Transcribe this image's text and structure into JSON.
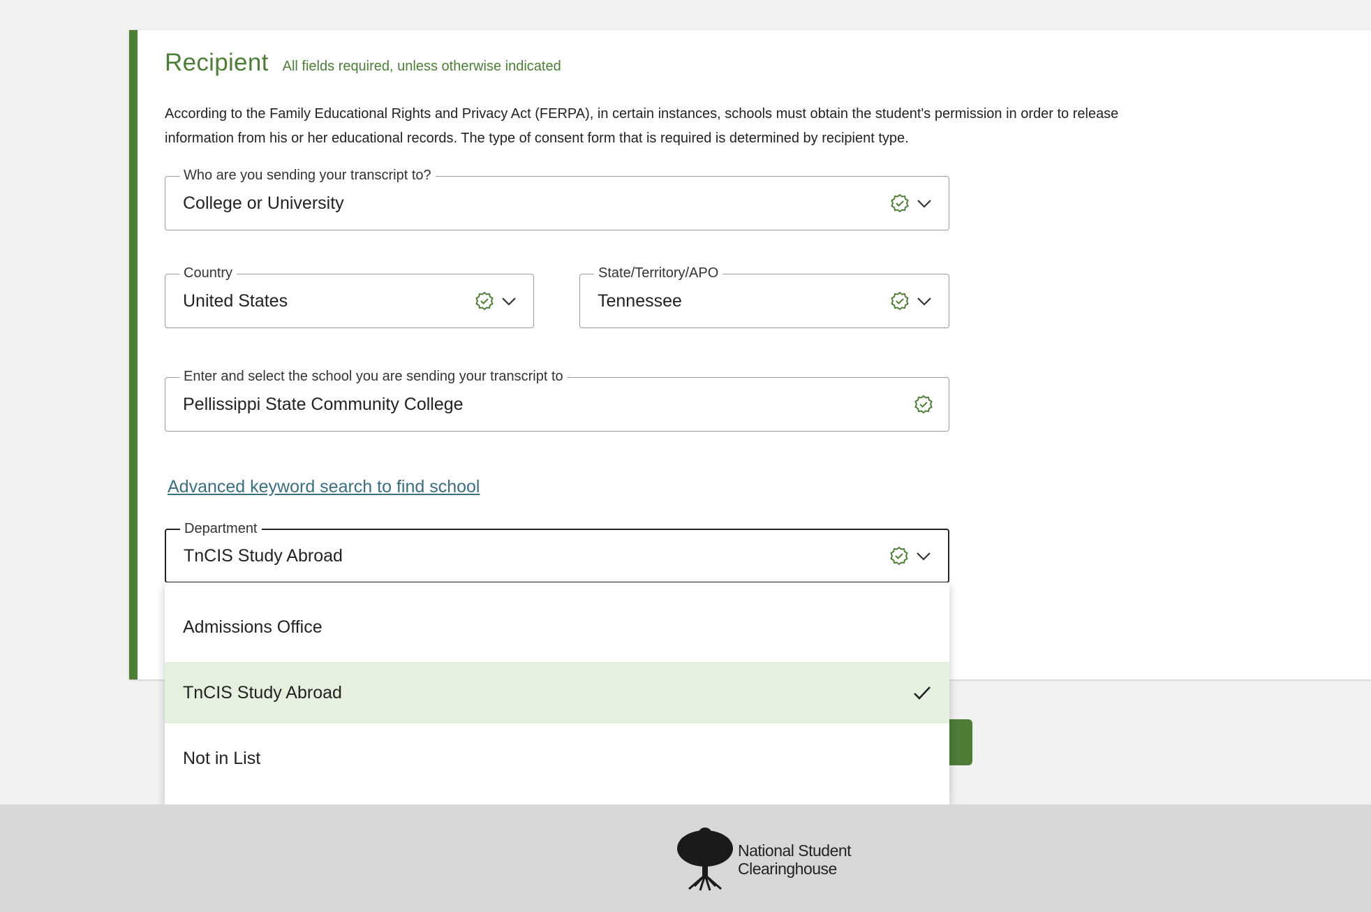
{
  "recipient": {
    "title": "Recipient",
    "subtitle": "All fields required, unless otherwise indicated",
    "intro": "According to the Family Educational Rights and Privacy Act (FERPA), in certain instances, schools must obtain the student's permission in order to release information from his or her educational records. The type of consent form that is required is determined by recipient type."
  },
  "fields": {
    "recipient_type": {
      "label": "Who are you sending your transcript to?",
      "value": "College or University"
    },
    "country": {
      "label": "Country",
      "value": "United States"
    },
    "state": {
      "label": "State/Territory/APO",
      "value": "Tennessee"
    },
    "school": {
      "label": "Enter and select the school you are sending your transcript to",
      "value": "Pellissippi State Community College"
    },
    "department": {
      "label": "Department",
      "value": "TnCIS Study Abroad"
    }
  },
  "advanced_search_link": "Advanced keyword search to find school",
  "department_options": [
    {
      "label": "Admissions Office",
      "selected": false
    },
    {
      "label": "TnCIS Study Abroad",
      "selected": true
    },
    {
      "label": "Not in List",
      "selected": false
    }
  ],
  "footer": {
    "logo_line1": "National Student",
    "logo_line2": "Clearinghouse"
  },
  "colors": {
    "brand_green": "#4e7d38",
    "selected_option_bg": "#e6f0df",
    "link": "#3a6e80",
    "footer_bg": "#d7d7d7"
  },
  "icons": {
    "valid": "verified-badge-icon",
    "dropdown": "chevron-down-icon",
    "selected": "checkmark-icon"
  }
}
